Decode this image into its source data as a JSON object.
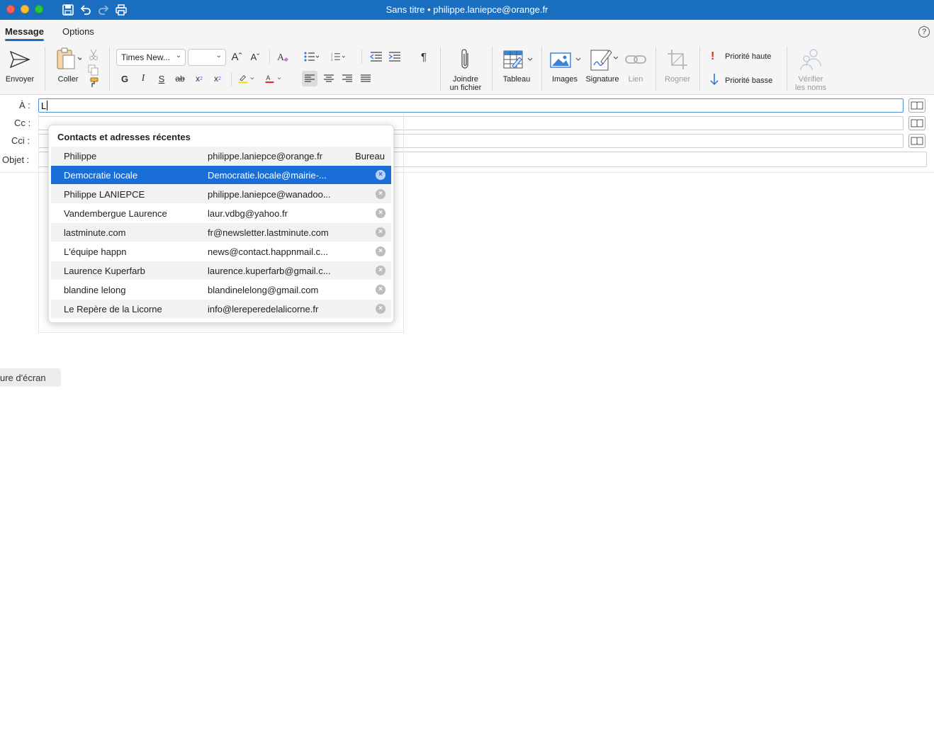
{
  "window": {
    "title": "Sans titre • philippe.laniepce@orange.fr"
  },
  "tabs": [
    {
      "label": "Message"
    },
    {
      "label": "Options"
    }
  ],
  "help_label": "?",
  "ribbon": {
    "send_label": "Envoyer",
    "paste_label": "Coller",
    "font_name": "Times New...",
    "font_size": "",
    "bold_label": "G",
    "italic_label": "I",
    "underline_label": "S",
    "strike_label": "ab",
    "pilcrow_label": "¶",
    "attach_label_1": "Joindre",
    "attach_label_2": "un fichier",
    "table_label": "Tableau",
    "images_label": "Images",
    "signature_label": "Signature",
    "link_label": "Lien",
    "crop_label": "Rogner",
    "priority_high": "Priorité haute",
    "priority_low": "Priorité basse",
    "check_names_1": "Vérifier",
    "check_names_2": "les noms"
  },
  "fields": {
    "to_label": "À :",
    "to_value": "L",
    "cc_label": "Cc :",
    "bcc_label": "Cci :",
    "subject_label": "Objet :"
  },
  "suggestions": {
    "title": "Contacts et adresses récentes",
    "items": [
      {
        "name": "Philippe",
        "email": "philippe.laniepce@orange.fr",
        "tag": "Bureau"
      },
      {
        "name": "Democratie locale",
        "email": "Democratie.locale@mairie-...",
        "tag": ""
      },
      {
        "name": "Philippe LANIEPCE",
        "email": "philippe.laniepce@wanadoo...",
        "tag": ""
      },
      {
        "name": "Vandembergue Laurence",
        "email": "laur.vdbg@yahoo.fr",
        "tag": ""
      },
      {
        "name": "lastminute.com",
        "email": "fr@newsletter.lastminute.com",
        "tag": ""
      },
      {
        "name": "L'équipe happn",
        "email": "news@contact.happnmail.c...",
        "tag": ""
      },
      {
        "name": "Laurence Kuperfarb",
        "email": "laurence.kuperfarb@gmail.c...",
        "tag": ""
      },
      {
        "name": "blandine lelong",
        "email": "blandinelelong@gmail.com",
        "tag": ""
      },
      {
        "name": "Le Repère de la Licorne",
        "email": "info@lereperedelalicorne.fr",
        "tag": ""
      }
    ],
    "delete_symbol": "×"
  },
  "tooltip": "ure d'écran",
  "colors": {
    "accent": "#1a6ebf",
    "selection": "#1a6ed8",
    "highlight_yellow": "#f5e400",
    "font_red": "#e02020",
    "priority_red": "#d9261c",
    "priority_blue": "#2a6fd6"
  }
}
